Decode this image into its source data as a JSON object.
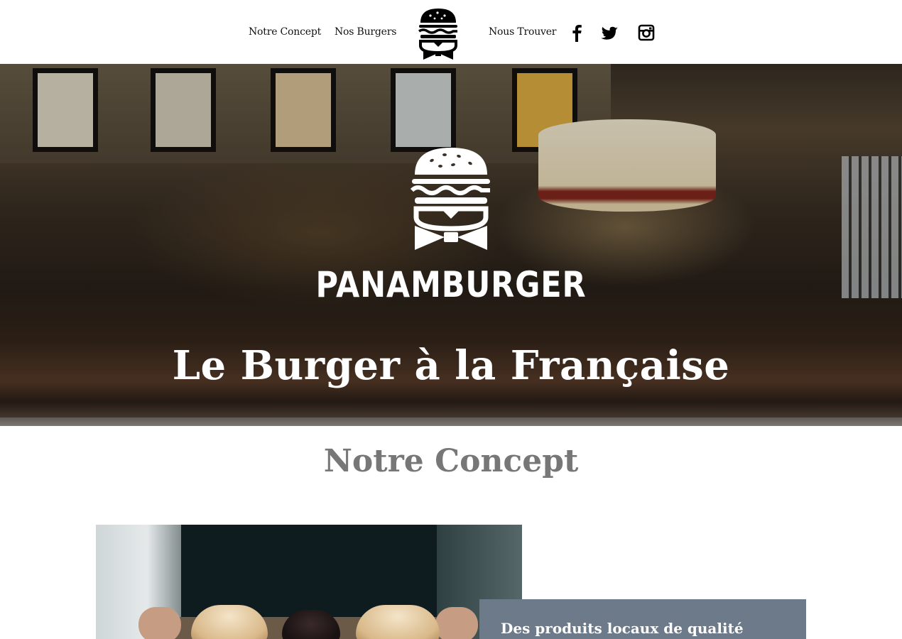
{
  "nav": {
    "links": [
      {
        "label": "Notre Concept"
      },
      {
        "label": "Nos Burgers"
      },
      {
        "label": "Nous Trouver"
      }
    ],
    "logo_icon": "burger-bowtie-logo-icon",
    "social": [
      {
        "icon": "facebook-icon"
      },
      {
        "icon": "twitter-icon"
      },
      {
        "icon": "instagram-icon"
      }
    ]
  },
  "hero": {
    "brand": "PANAMBURGER",
    "tagline": "Le Burger à la Française",
    "logo_icon": "burger-bowtie-logo-icon"
  },
  "concept": {
    "title": "Notre Concept",
    "caption": "Des produits locaux de qualité"
  },
  "colors": {
    "title_gray": "#777777",
    "caption_bg": "#6d7a89",
    "nav_text": "#111111"
  }
}
